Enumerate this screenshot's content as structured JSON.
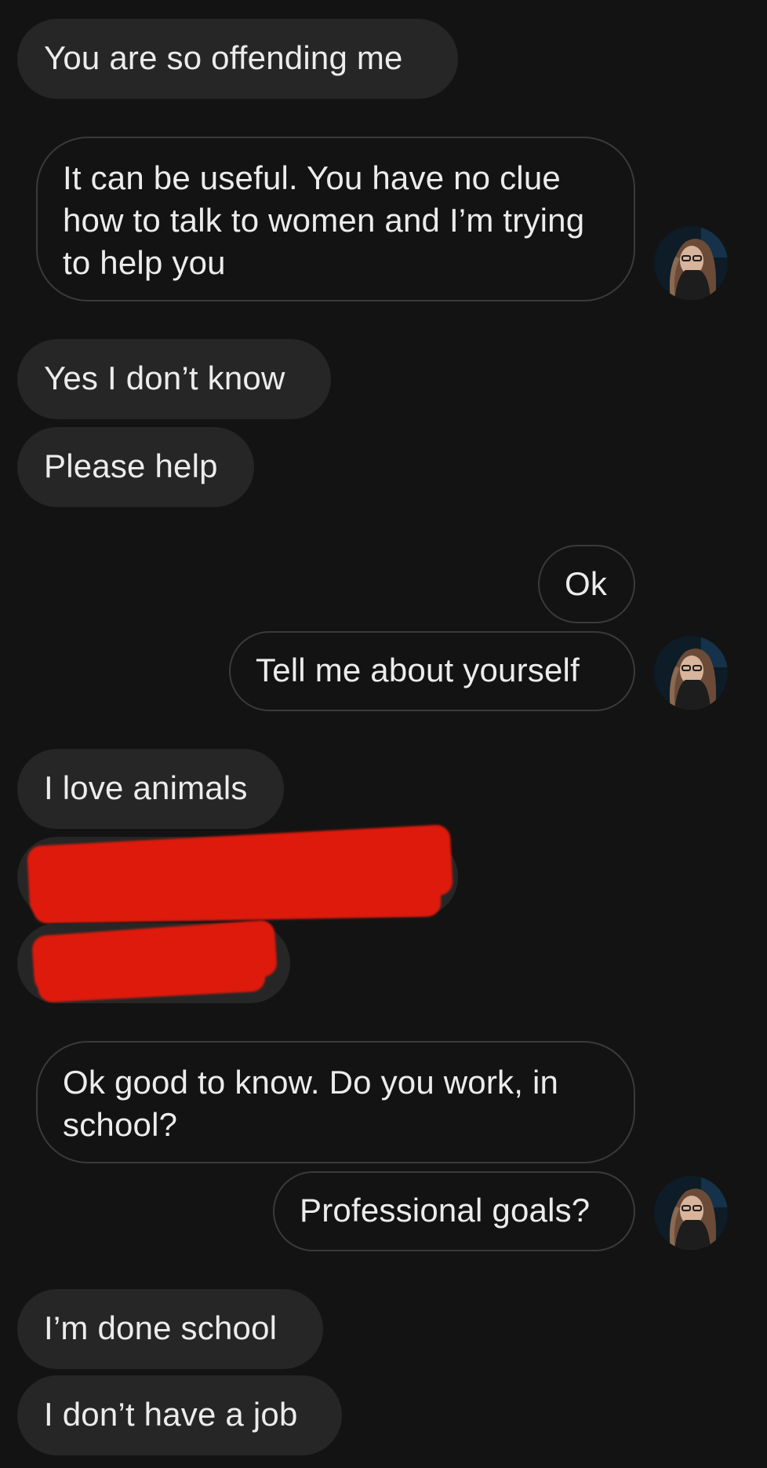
{
  "messages": [
    {
      "id": "m1",
      "direction": "incoming",
      "text": "You are so offending me"
    },
    {
      "id": "m2",
      "direction": "outgoing",
      "text": "It can be useful. You have no clue how to talk to women and I’m trying to help you"
    },
    {
      "id": "m3",
      "direction": "incoming",
      "text": "Yes I don’t know"
    },
    {
      "id": "m4",
      "direction": "incoming",
      "text": "Please help"
    },
    {
      "id": "m5",
      "direction": "outgoing",
      "text": "Ok"
    },
    {
      "id": "m6",
      "direction": "outgoing",
      "text": "Tell me about yourself"
    },
    {
      "id": "m7",
      "direction": "incoming",
      "text": "I love animals"
    },
    {
      "id": "m8",
      "direction": "incoming",
      "text": "",
      "redacted": true
    },
    {
      "id": "m9",
      "direction": "incoming",
      "text": "",
      "redacted": true
    },
    {
      "id": "m10",
      "direction": "outgoing",
      "text": "Ok good to know. Do you work, in school?"
    },
    {
      "id": "m11",
      "direction": "outgoing",
      "text": "Professional goals?"
    },
    {
      "id": "m12",
      "direction": "incoming",
      "text": "I’m done school"
    },
    {
      "id": "m13",
      "direction": "incoming",
      "text": "I don’t have a job"
    }
  ],
  "theme": {
    "background": "#131313",
    "incoming_bubble": "#262626",
    "outgoing_border": "#3a3a3a",
    "text": "#ececec",
    "redaction": "#dd1a0c"
  },
  "avatar": {
    "icon": "user-avatar-photo"
  }
}
